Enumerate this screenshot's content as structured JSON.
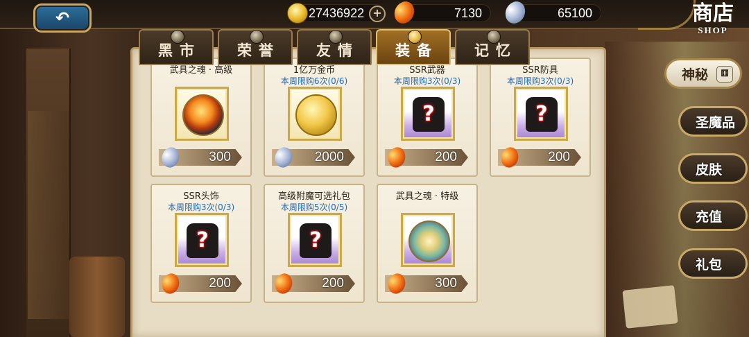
{
  "header": {
    "back_icon": "back-arrow-icon",
    "gold": "27436922",
    "ruby": "7130",
    "crystal": "65100",
    "shop_title_cn": "商店",
    "shop_title_en": "SHOP"
  },
  "tabs": [
    {
      "label": "黑市",
      "active": false
    },
    {
      "label": "荣誉",
      "active": false
    },
    {
      "label": "友情",
      "active": false
    },
    {
      "label": "装备",
      "active": true
    },
    {
      "label": "记忆",
      "active": false
    }
  ],
  "items": [
    {
      "title": "武具之魂 · 高级",
      "limit": "",
      "price": "300",
      "currency": "crystal",
      "icon": "soul-orb-fire-icon"
    },
    {
      "title": "1亿万金币",
      "limit": "本周限购6次(0/6)",
      "price": "2000",
      "currency": "crystal",
      "icon": "gold-coins-icon"
    },
    {
      "title": "SSR武器",
      "limit": "本周限购3次(0/3)",
      "price": "200",
      "currency": "ruby",
      "icon": "mystery-weapon-icon"
    },
    {
      "title": "SSR防具",
      "limit": "本周限购3次(0/3)",
      "price": "200",
      "currency": "ruby",
      "icon": "mystery-armor-icon"
    },
    {
      "title": "SSR头饰",
      "limit": "本周限购3次(0/3)",
      "price": "200",
      "currency": "ruby",
      "icon": "mystery-headgear-icon"
    },
    {
      "title": "高级附魔可选礼包",
      "limit": "本周限购5次(0/5)",
      "price": "200",
      "currency": "ruby",
      "icon": "mystery-scroll-icon"
    },
    {
      "title": "武具之魂 · 特级",
      "limit": "",
      "price": "300",
      "currency": "ruby",
      "icon": "soul-orb-spirit-icon"
    }
  ],
  "side_menu": [
    {
      "label": "神秘",
      "icon": "dice-icon",
      "active": true
    },
    {
      "label": "圣魔品",
      "icon": "relic-icon",
      "active": false
    },
    {
      "label": "皮肤",
      "icon": "skin-icon",
      "active": false
    },
    {
      "label": "充值",
      "icon": "recharge-icon",
      "active": false
    },
    {
      "label": "礼包",
      "icon": "gift-icon",
      "active": false
    }
  ],
  "colors": {
    "limit_text": "#1c69b8",
    "tab_active": "#a06f25",
    "panel_bg": "#e7dcc4"
  }
}
